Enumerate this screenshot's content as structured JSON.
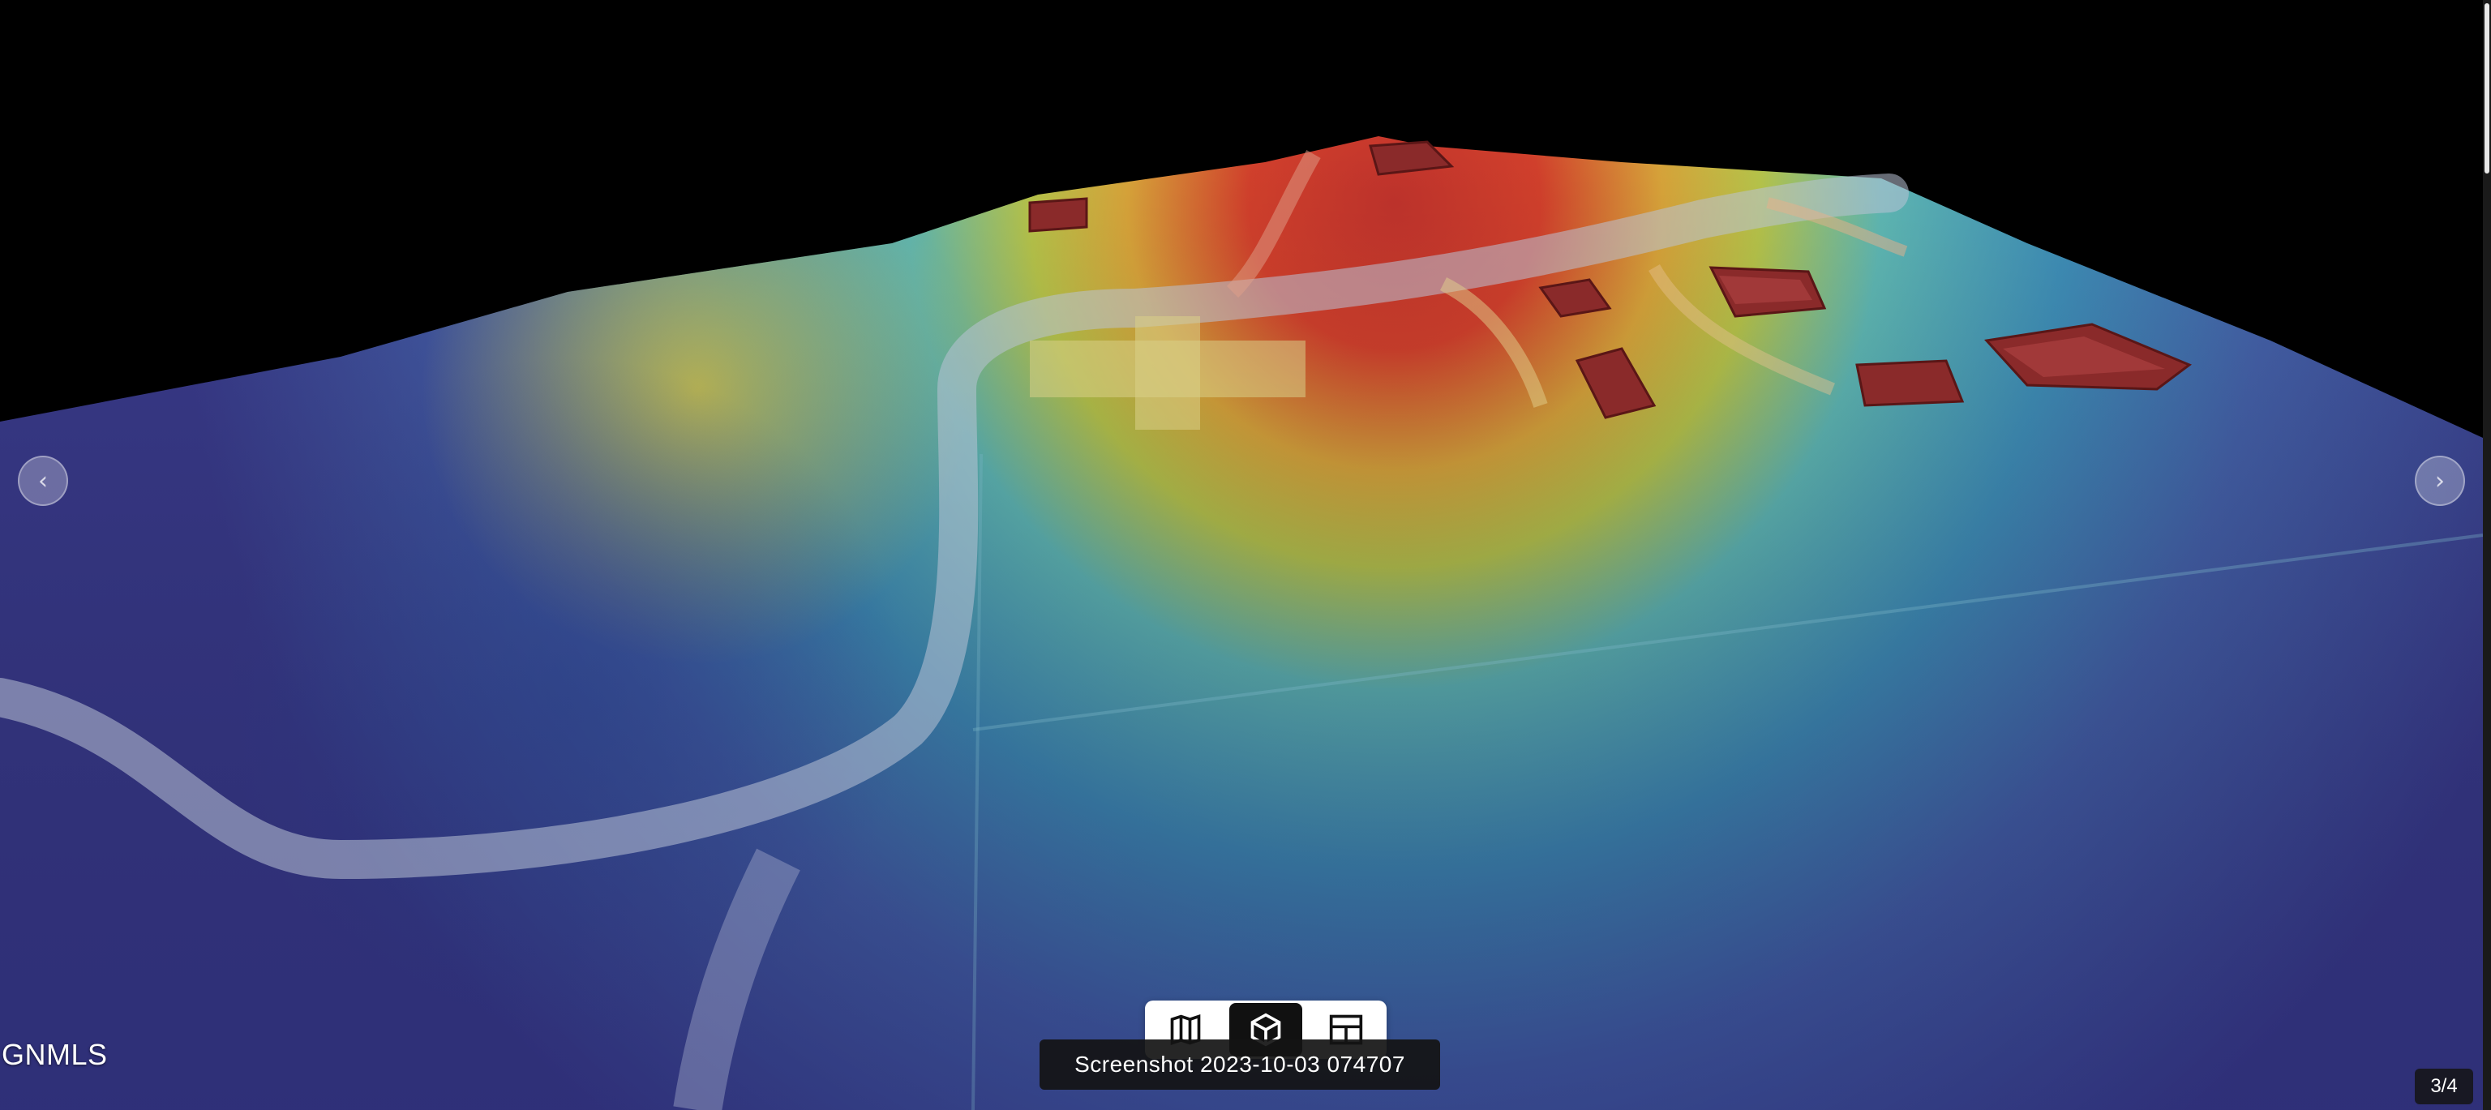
{
  "viewer": {
    "image_label": "3D terrain elevation heatmap of property",
    "watermark": "GNMLS",
    "caption": "Screenshot 2023-10-03 074707",
    "counter": "3/4",
    "prev_icon": "chevron-left-icon",
    "next_icon": "chevron-right-icon",
    "prev_glyph": "‹",
    "next_glyph": "›"
  },
  "view_toggle": {
    "buttons": [
      {
        "name": "map-view",
        "icon": "map-icon",
        "active": false
      },
      {
        "name": "3d-view",
        "icon": "cube-icon",
        "active": true
      },
      {
        "name": "gallery-view",
        "icon": "grid-icon",
        "active": false
      }
    ]
  },
  "colors": {
    "background": "#000000",
    "toggle_bg": "#ffffff",
    "active_btn": "#111111",
    "caption_bg": "#141414"
  }
}
